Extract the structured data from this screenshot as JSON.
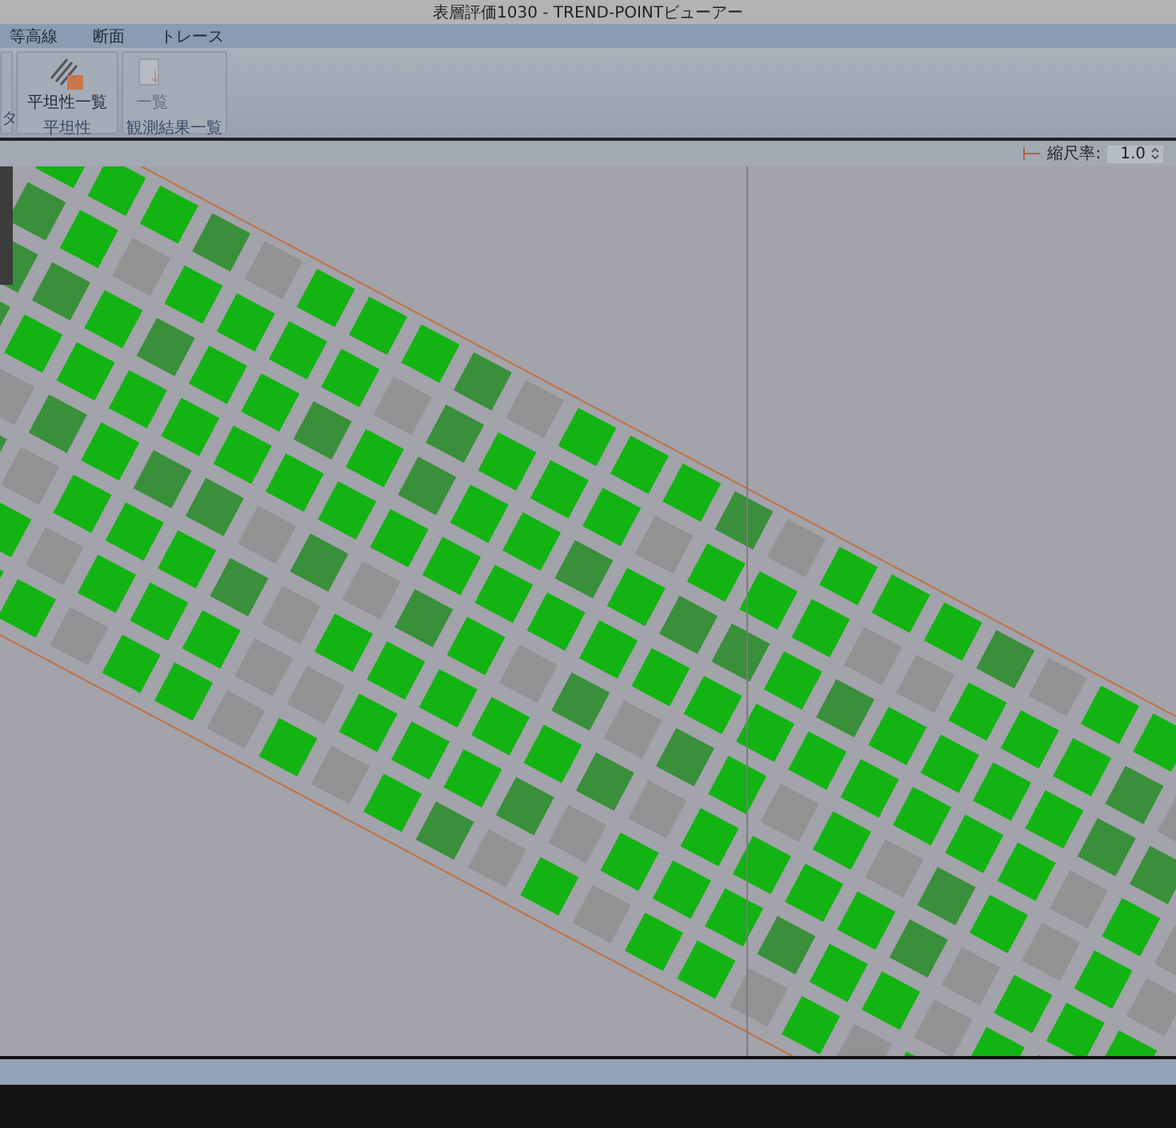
{
  "window": {
    "title": "表層評価1030 - TREND-POINTビューアー"
  },
  "menu": [
    "等高線",
    "断面",
    "トレース"
  ],
  "ribbon": {
    "groups": [
      {
        "label": "タ"
      },
      {
        "label": "平坦性",
        "buttons": [
          {
            "label": "平坦性一覧",
            "disabled": false
          }
        ]
      },
      {
        "label": "観測結果一覧",
        "buttons": [
          {
            "label": "一覧",
            "disabled": true
          }
        ]
      }
    ]
  },
  "toolbar": {
    "scale_label": "縮尺率:",
    "scale_value": "1.0"
  }
}
